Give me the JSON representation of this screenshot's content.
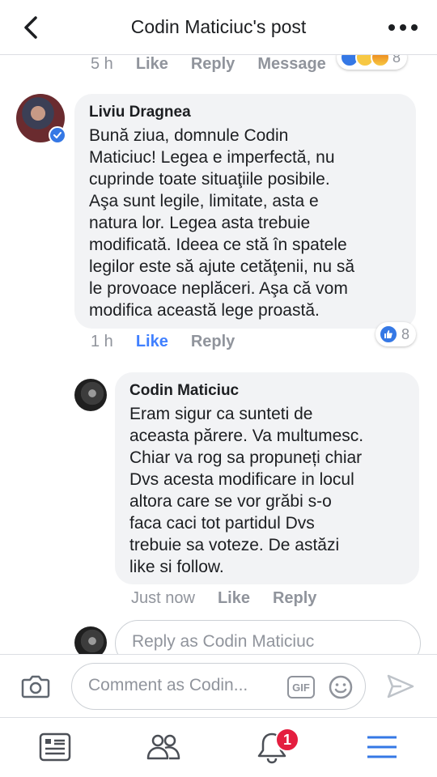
{
  "header": {
    "title": "Codin Maticiuc's post"
  },
  "previous_comment": {
    "time": "5 h",
    "like_label": "Like",
    "reply_label": "Reply",
    "message_label": "Message",
    "reaction_count": "8"
  },
  "comment_main": {
    "author": "Liviu Dragnea",
    "text": "Bună ziua, domnule Codin\nMaticiuc! Legea e imperfectă, nu\ncuprinde toate situaţiile posibile.\nAşa sunt legile, limitate, asta e\nnatura lor. Legea asta trebuie\nmodificată. Ideea ce stă în spatele\nlegilor este să ajute cetăţenii, nu să\nle provoace neplăceri. Aşa că vom\nmodifica această lege proastă.",
    "time": "1 h",
    "like_label": "Like",
    "reply_label": "Reply",
    "reaction_count": "8",
    "verified": true
  },
  "reply_comment": {
    "author": "Codin Maticiuc",
    "text": "Eram sigur ca sunteti de\naceasta părere. Va multumesc.\nChiar va rog sa propuneți chiar\nDvs acesta modificare in locul\naltora care se vor grăbi s-o\nfaca caci tot partidul Dvs\ntrebuie sa voteze. De astăzi\nlike si follow.",
    "time": "Just now",
    "like_label": "Like",
    "reply_label": "Reply"
  },
  "reply_box": {
    "placeholder": "Reply as Codin Maticiuc"
  },
  "composer": {
    "placeholder": "Comment as Codin...",
    "gif_label": "GIF"
  },
  "bottom_nav": {
    "notifications_badge": "1",
    "active_tab": "menu"
  },
  "colors": {
    "accent": "#3578e5",
    "like_active": "#4080ff",
    "bubble": "#f2f3f5",
    "meta_text": "#90949c",
    "badge": "#e41e3f"
  }
}
